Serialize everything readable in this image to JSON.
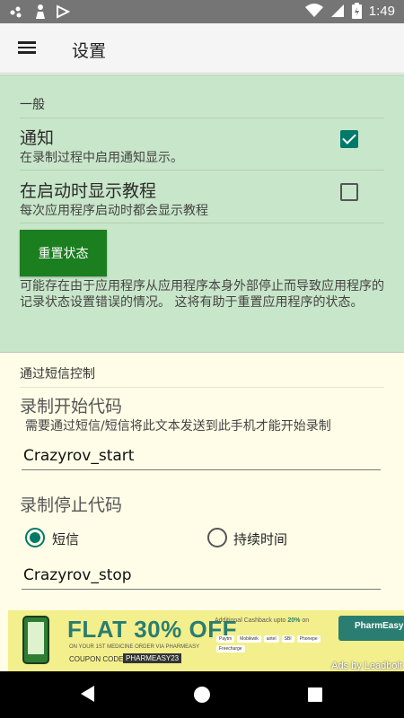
{
  "status_bar": {
    "time": "1:49",
    "icons": [
      "notification-dots-icon",
      "person-icon",
      "play-store-icon",
      "wifi-icon",
      "signal-icon",
      "battery-icon"
    ]
  },
  "app_bar": {
    "title": "设置",
    "menu_icon": "hamburger-menu-icon"
  },
  "general": {
    "header": "一般",
    "notification": {
      "title": "通知",
      "summary": "在录制过程中启用通知显示。",
      "checked": true
    },
    "tutorial": {
      "title": "在启动时显示教程",
      "summary": "每次应用程序启动时都会显示教程",
      "checked": false
    },
    "reset_button": "重置状态",
    "reset_description": "可能存在由于应用程序从应用程序本身外部停止而导致应用程序的记录状态设置错误的情况。 这将有助于重置应用程序的状态。"
  },
  "sms": {
    "header": "通过短信控制",
    "start_code": {
      "title": "录制开始代码",
      "summary": "需要通过短信/短信将此文本发送到此手机才能开始录制",
      "value": "Crazyrov_start"
    },
    "stop_code": {
      "title": "录制停止代码",
      "value": "Crazyrov_stop"
    },
    "stop_mode": {
      "options": [
        "短信",
        "持续时间"
      ],
      "selected": "短信"
    }
  },
  "ad": {
    "headline": "FLAT 30% OFF",
    "subline": "ON YOUR 1ST MEDICINE ORDER VIA PHARMEASY",
    "coupon_label": "COUPON CODE :",
    "coupon_code": "PHARMEASY23",
    "cashback_text": "Additional Cashback upto",
    "cashback_value": "20%",
    "cashback_suffix": "on",
    "payments": [
      "Paytm",
      "Mobikwik",
      "airtel",
      "SBI",
      "Phonepe",
      "Freecharge"
    ],
    "brand": "PharmEasy",
    "by_label": "Ads by Leadbolt"
  },
  "colors": {
    "status_bar": "#757575",
    "general_bg": "#c8e6c9",
    "sms_bg": "#fffde7",
    "accent": "#00796b",
    "reset_button": "#1b7e1f",
    "nav_bar": "#000000"
  }
}
